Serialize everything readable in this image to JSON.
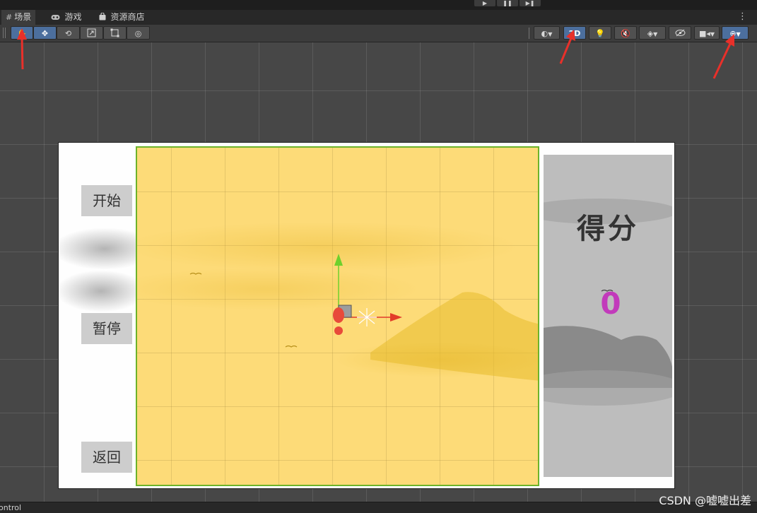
{
  "tabs": [
    {
      "label": "场景",
      "icon": "grid-icon"
    },
    {
      "label": "游戏",
      "icon": "gamepad-icon"
    },
    {
      "label": "资源商店",
      "icon": "shopping-bag-icon"
    }
  ],
  "toolbar": {
    "tools": [
      "hand-tool-icon",
      "move-tool-icon",
      "rotate-tool-icon",
      "scale-tool-icon",
      "rect-tool-icon",
      "transform-tool-icon"
    ],
    "right": {
      "shading_icon": "shading-mode-icon",
      "mode_2d_label": "2D",
      "lighting_icon": "lighting-icon",
      "audio_icon": "audio-mute-icon",
      "effects_icon": "effects-icon",
      "visibility_icon": "hidden-visibility-icon",
      "camera_icon": "scene-camera-icon",
      "gizmos_icon": "gizmos-icon"
    },
    "more_icon": "more-vertical-icon"
  },
  "playbar": {
    "play": "▶",
    "pause": "❚❚",
    "step": "▶❚"
  },
  "scene": {
    "buttons": {
      "start": "开始",
      "pause": "暂停",
      "back": "返回"
    },
    "score_label": "得分",
    "score_value": "0"
  },
  "colors": {
    "accent": "#4c6f9e",
    "game_panel": "#fddb78",
    "game_panel_border": "#6db32a",
    "score_value": "#c23bbb",
    "annotation_arrow": "#e8302a"
  },
  "bottom": {
    "tab_label": "ontrol"
  },
  "watermark": "CSDN @嘘嘘出差"
}
